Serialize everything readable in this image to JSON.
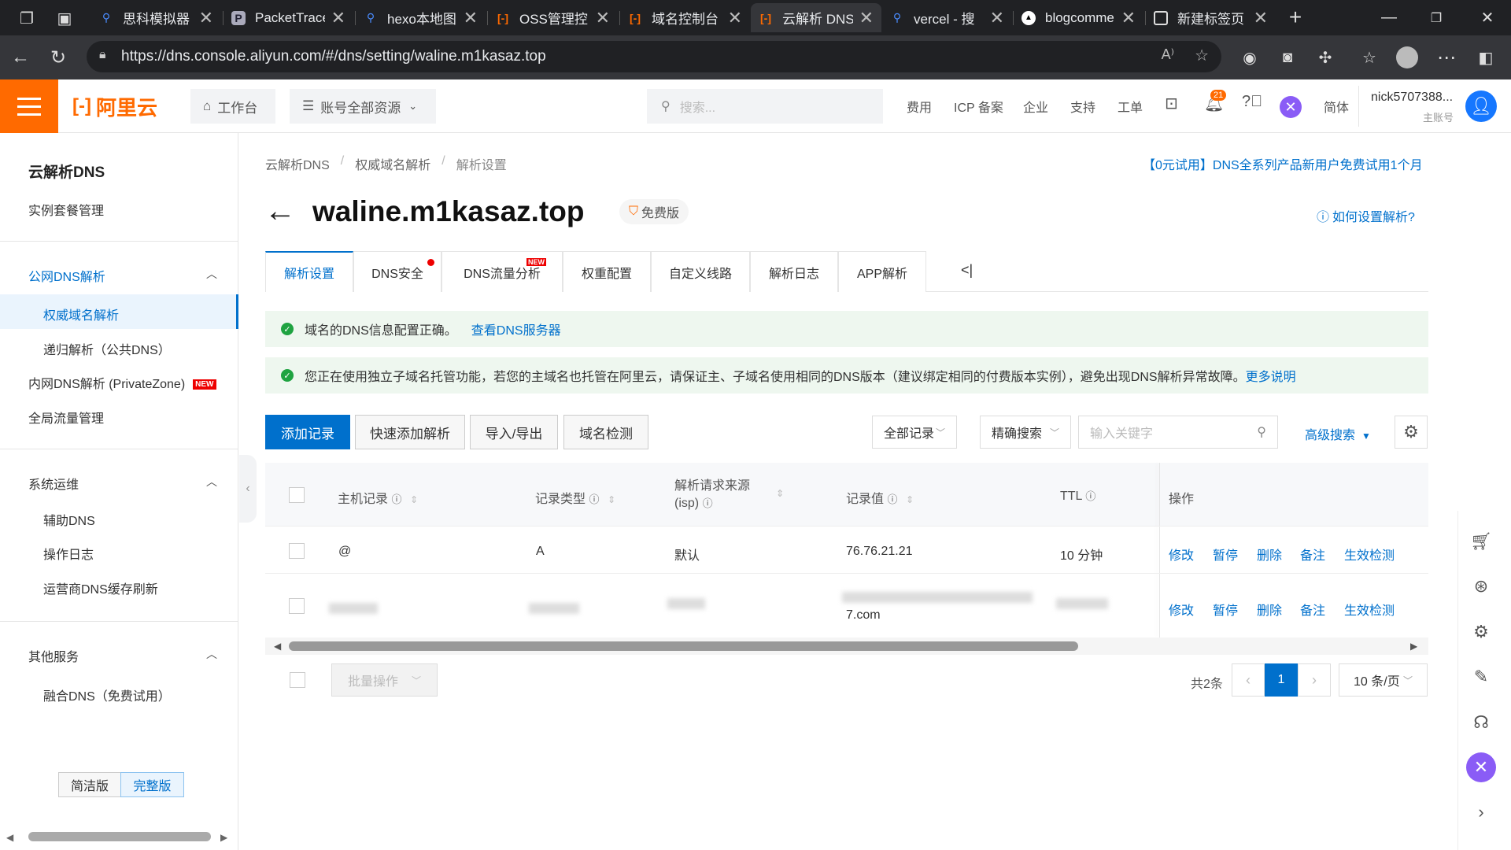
{
  "browser": {
    "tabs": [
      {
        "title": "思科模拟器",
        "icon": "search-icon"
      },
      {
        "title": "PacketTrace",
        "icon": "app-icon"
      },
      {
        "title": "hexo本地图",
        "icon": "search-icon"
      },
      {
        "title": "OSS管理控",
        "icon": "aliyun-icon"
      },
      {
        "title": "域名控制台",
        "icon": "aliyun-icon"
      },
      {
        "title": "云解析 DNS",
        "icon": "aliyun-icon"
      },
      {
        "title": "vercel - 搜",
        "icon": "search-icon"
      },
      {
        "title": "blogcomme",
        "icon": "vercel-icon"
      },
      {
        "title": "新建标签页",
        "icon": "newtab-icon"
      }
    ],
    "active_tab_index": 5,
    "url": "https://dns.console.aliyun.com/#/dns/setting/waline.m1kasaz.top"
  },
  "header": {
    "logo": "阿里云",
    "workbench": "工作台",
    "resources": "账号全部资源",
    "search_placeholder": "搜索...",
    "links": [
      "费用",
      "ICP 备案",
      "企业",
      "支持",
      "工单"
    ],
    "notif_count": "21",
    "lang": "简体",
    "user_name": "nick5707388...",
    "user_role": "主账号"
  },
  "sidebar": {
    "title": "云解析DNS",
    "instance": "实例套餐管理",
    "group1": {
      "label": "公网DNS解析",
      "items": [
        "权威域名解析",
        "递归解析（公共DNS）"
      ]
    },
    "private_zone": "内网DNS解析 (PrivateZone)",
    "private_zone_badge": "NEW",
    "global_traffic": "全局流量管理",
    "group2": {
      "label": "系统运维",
      "items": [
        "辅助DNS",
        "操作日志",
        "运营商DNS缓存刷新"
      ]
    },
    "group3": {
      "label": "其他服务",
      "items": [
        "融合DNS（免费试用）"
      ]
    },
    "mode_simple": "简洁版",
    "mode_full": "完整版"
  },
  "main": {
    "breadcrumb": [
      "云解析DNS",
      "权威域名解析",
      "解析设置"
    ],
    "promo": "【0元试用】DNS全系列产品新用户免费试用1个月",
    "domain": "waline.m1kasaz.top",
    "edition": "免费版",
    "help": "如何设置解析?",
    "tabs": [
      "解析设置",
      "DNS安全",
      "DNS流量分析",
      "权重配置",
      "自定义线路",
      "解析日志",
      "APP解析"
    ],
    "new_badge": "NEW",
    "notice1": "域名的DNS信息配置正确。",
    "notice1_link": "查看DNS服务器",
    "notice2": "您正在使用独立子域名托管功能，若您的主域名也托管在阿里云，请保证主、子域名使用相同的DNS版本（建议绑定相同的付费版本实例），避免出现DNS解析异常故障。",
    "notice2_link": "更多说明",
    "actions": [
      "添加记录",
      "快速添加解析",
      "导入/导出",
      "域名检测"
    ],
    "filter_all": "全部记录",
    "filter_exact": "精确搜索",
    "keyword_placeholder": "输入关键字",
    "advanced": "高级搜索",
    "columns": [
      "主机记录",
      "记录类型",
      "解析请求来源(isp)",
      "记录值",
      "TTL",
      "操作"
    ],
    "rows": [
      {
        "host": "@",
        "type": "A",
        "line": "默认",
        "value": "76.76.21.21",
        "ttl": "10 分钟"
      },
      {
        "host": "",
        "type": "",
        "line": "",
        "value": "7.com",
        "ttl": ""
      }
    ],
    "row_ops": [
      "修改",
      "暂停",
      "删除",
      "备注",
      "生效检测"
    ],
    "batch": "批量操作",
    "total": "共2条",
    "page": "1",
    "page_size": "10 条/页"
  },
  "colors": {
    "accent": "#0070cc",
    "brand": "#ff6a00",
    "ok": "#1fa341"
  }
}
